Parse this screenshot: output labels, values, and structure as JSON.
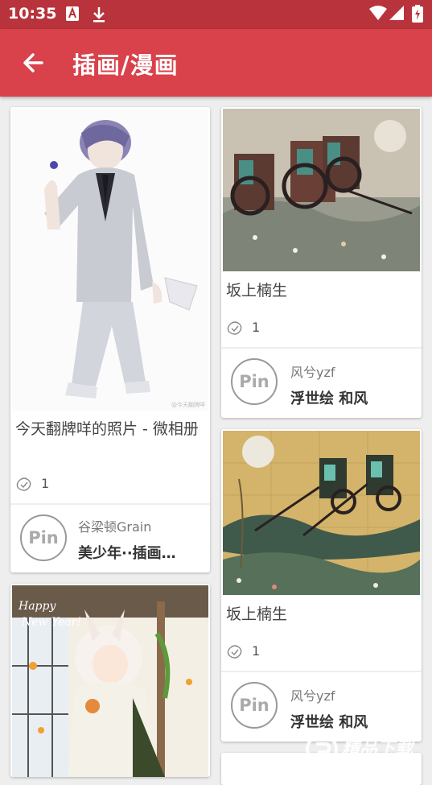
{
  "status_bar": {
    "time": "10:35"
  },
  "header": {
    "title": "插画/漫画"
  },
  "cards": [
    {
      "title": "今天翻牌咩的照片 - 微相册",
      "likes": "1",
      "avatar_text": "Pin",
      "author": "谷梁顿Grain",
      "board": "美少年··插画…"
    },
    {
      "title": "坂上楠生",
      "likes": "1",
      "avatar_text": "Pin",
      "author": "风兮yzf",
      "board": "浮世绘 和风"
    },
    {
      "title": "坂上楠生",
      "likes": "1",
      "avatar_text": "Pin",
      "author": "风兮yzf",
      "board": "浮世绘 和风"
    }
  ],
  "watermark": {
    "text": "精品下载",
    "url": "www.jingpinxz.com"
  },
  "colors": {
    "status_bar": "#b8333b",
    "app_bar": "#d9414b",
    "background": "#eeeeee"
  }
}
